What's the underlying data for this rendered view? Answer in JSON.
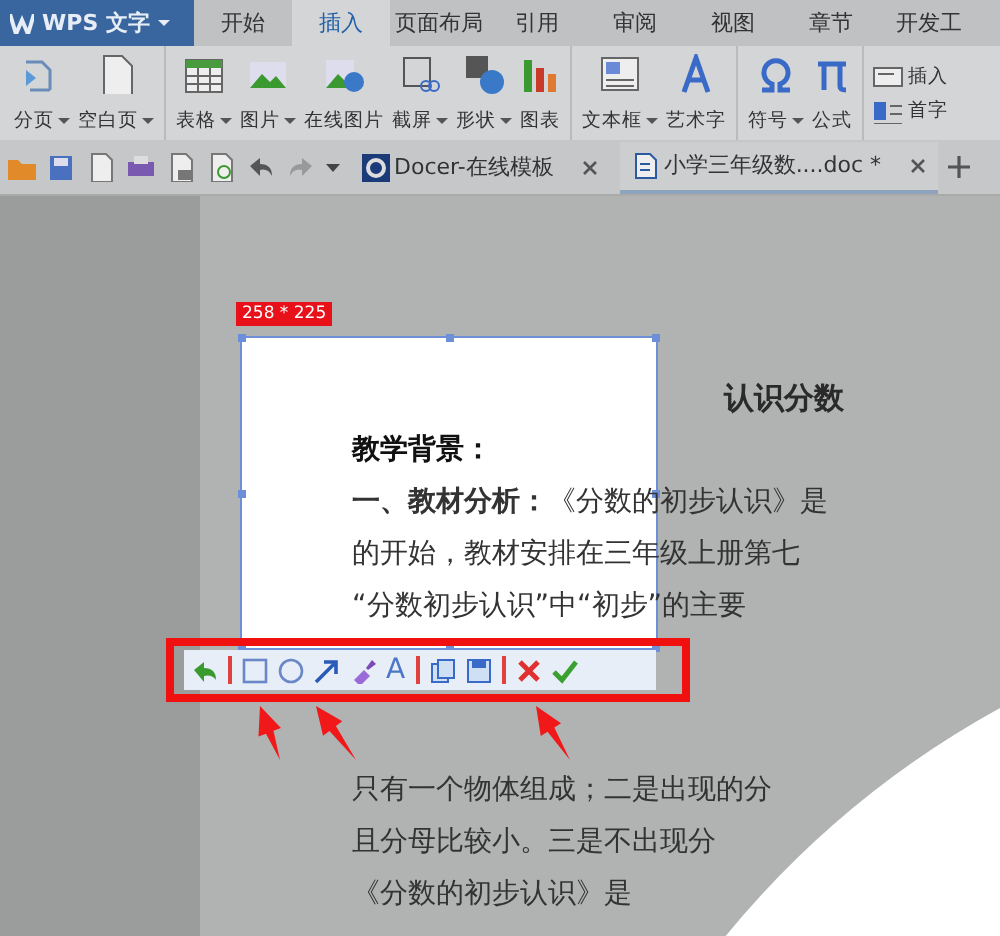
{
  "app_tab": {
    "label": "WPS 文字"
  },
  "menu_tabs": [
    {
      "label": "开始",
      "selected": false
    },
    {
      "label": "插入",
      "selected": true
    },
    {
      "label": "页面布局",
      "selected": false
    },
    {
      "label": "引用",
      "selected": false
    },
    {
      "label": "审阅",
      "selected": false
    },
    {
      "label": "视图",
      "selected": false
    },
    {
      "label": "章节",
      "selected": false
    },
    {
      "label": "开发工",
      "selected": false
    }
  ],
  "ribbon_groups": [
    [
      {
        "label": "分页",
        "dropdown": true
      },
      {
        "label": "空白页",
        "dropdown": true
      }
    ],
    [
      {
        "label": "表格",
        "dropdown": true
      },
      {
        "label": "图片",
        "dropdown": true
      },
      {
        "label": "在线图片",
        "dropdown": false
      },
      {
        "label": "截屏",
        "dropdown": true
      },
      {
        "label": "形状",
        "dropdown": true
      },
      {
        "label": "图表",
        "dropdown": false
      }
    ],
    [
      {
        "label": "文本框",
        "dropdown": true
      },
      {
        "label": "艺术字",
        "dropdown": false
      }
    ],
    [
      {
        "label": "符号",
        "dropdown": true
      },
      {
        "label": "公式",
        "dropdown": false
      }
    ],
    [
      {
        "label": "插入",
        "dropdown": false,
        "kind": "small"
      },
      {
        "label": "首字",
        "dropdown": false,
        "kind": "small"
      }
    ]
  ],
  "doc_tabs": [
    {
      "title": "Docer-在线模板",
      "selected": false
    },
    {
      "title": "小学三年级数....doc *",
      "selected": true
    }
  ],
  "document": {
    "title": "认识分数",
    "lines": [
      {
        "kind": "heading",
        "text": "教学背景："
      },
      {
        "kind": "body",
        "text": "**一、教材分析：**《分数的初步认识》是"
      },
      {
        "kind": "body",
        "text": "的开始，教材安排在三年级上册第七"
      },
      {
        "kind": "body",
        "text": "“分数初步认识”中“初步”的主要"
      },
      {
        "kind": "body",
        "text": "只有一个物体组成；二是出现的分"
      },
      {
        "kind": "body",
        "text": "且分母比较小。三是不出现分"
      },
      {
        "kind": "body",
        "text": "《分数的初步认识》是"
      }
    ]
  },
  "selection": {
    "size_label": "258 * 225"
  },
  "capture_toolbar": {
    "text_tool": "A"
  }
}
